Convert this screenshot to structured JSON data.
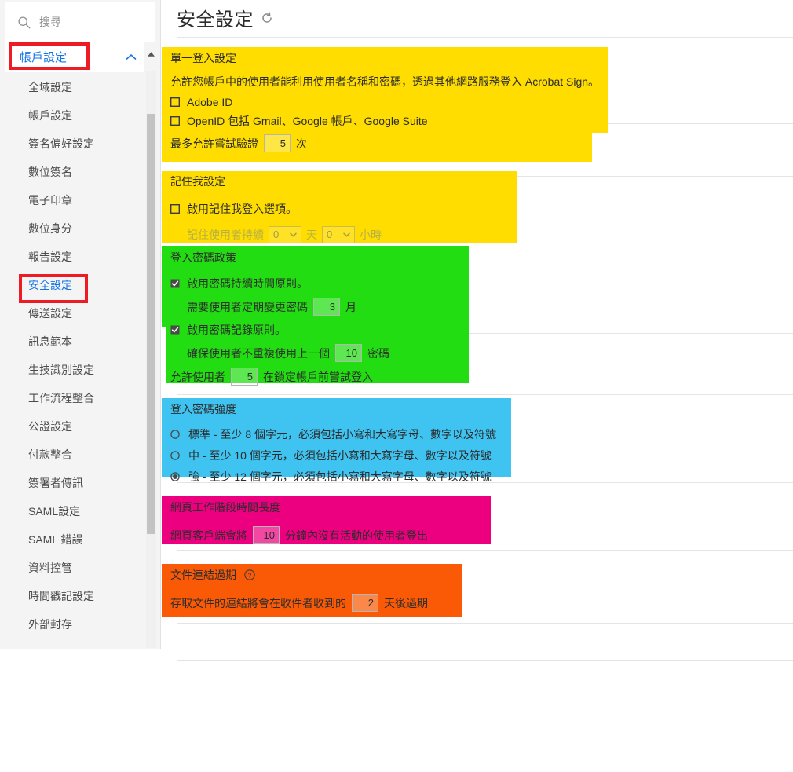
{
  "sidebar": {
    "search": {
      "placeholder": "搜尋",
      "value": "",
      "icon": "search-icon"
    },
    "account_header": {
      "label": "帳戶設定",
      "chevron": "chevron-up-icon"
    },
    "items": [
      {
        "label": "全域設定",
        "active": false
      },
      {
        "label": "帳戶設定",
        "active": false
      },
      {
        "label": "簽名偏好設定",
        "active": false
      },
      {
        "label": "數位簽名",
        "active": false
      },
      {
        "label": "電子印章",
        "active": false
      },
      {
        "label": "數位身分",
        "active": false
      },
      {
        "label": "報告設定",
        "active": false
      },
      {
        "label": "安全設定",
        "active": true
      },
      {
        "label": "傳送設定",
        "active": false
      },
      {
        "label": "訊息範本",
        "active": false
      },
      {
        "label": "生技識別設定",
        "active": false
      },
      {
        "label": "工作流程整合",
        "active": false
      },
      {
        "label": "公證設定",
        "active": false
      },
      {
        "label": "付款整合",
        "active": false
      },
      {
        "label": "簽署者傳訊",
        "active": false
      },
      {
        "label": "SAML設定",
        "active": false
      },
      {
        "label": "SAML 錯誤",
        "active": false
      },
      {
        "label": "資料控管",
        "active": false
      },
      {
        "label": "時間戳記設定",
        "active": false
      },
      {
        "label": "外部封存",
        "active": false
      }
    ]
  },
  "header": {
    "title": "安全設定",
    "refresh_icon": "refresh-icon"
  },
  "highlight_colors": {
    "yellow": "#FFDD00",
    "green": "#22DD11",
    "blue": "#3FC3F0",
    "magenta": "#ED0080",
    "orange": "#FA5A06",
    "annotation_red": "#ED1C24",
    "link_blue": "#1473E6"
  },
  "sections": {
    "sso": {
      "title": "單一登入設定",
      "description": "允許您帳戶中的使用者能利用使用者名稱和密碼，透過其他網路服務登入 Acrobat Sign。",
      "checkboxes": [
        {
          "label": "Adobe ID",
          "checked": false
        },
        {
          "label": "OpenID 包括 Gmail、Google 帳戶、Google Suite",
          "checked": false
        }
      ],
      "attempts_prefix": "最多允許嘗試驗證",
      "attempts_value": "5",
      "attempts_suffix": "次"
    },
    "remember_me": {
      "title": "記住我設定",
      "enable_label": "啟用記住我登入選項。",
      "enable_checked": false,
      "duration_prefix": "記住使用者持續",
      "days_value": "0",
      "days_unit": "天",
      "hours_value": "0",
      "hours_unit": "小時"
    },
    "password_policy": {
      "title": "登入密碼政策",
      "duration_rule_label": "啟用密碼持續時間原則。",
      "duration_rule_checked": true,
      "change_prefix": "需要使用者定期變更密碼",
      "change_value": "3",
      "change_suffix": "月",
      "history_rule_label": "啟用密碼記錄原則。",
      "history_rule_checked": true,
      "history_prefix": "確保使用者不重複使用上一個",
      "history_value": "10",
      "history_suffix": "密碼",
      "lockout_prefix": "允許使用者",
      "lockout_value": "5",
      "lockout_suffix": "在鎖定帳戶前嘗試登入"
    },
    "password_strength": {
      "title": "登入密碼強度",
      "options": [
        {
          "label": "標準 - 至少 8 個字元，必須包括小寫和大寫字母、數字以及符號",
          "selected": false
        },
        {
          "label": "中 - 至少 10 個字元，必須包括小寫和大寫字母、數字以及符號",
          "selected": false
        },
        {
          "label": "強 - 至少 12 個字元，必須包括小寫和大寫字母、數字以及符號",
          "selected": true
        }
      ]
    },
    "web_session": {
      "title": "網頁工作階段時間長度",
      "prefix": "網頁客戶端會將",
      "value": "10",
      "suffix": "分鐘內沒有活動的使用者登出"
    },
    "doc_link": {
      "title": "文件連結過期",
      "help_icon": "help-circle-icon",
      "prefix": "存取文件的連結將會在收件者收到的",
      "value": "2",
      "suffix": "天後過期"
    }
  }
}
